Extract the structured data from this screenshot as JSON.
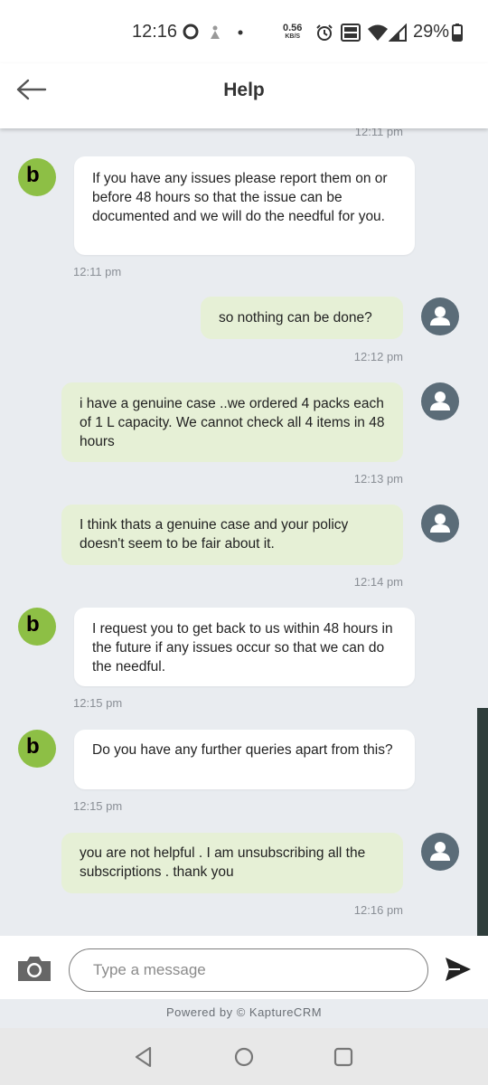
{
  "status_bar": {
    "time": "12:16",
    "net_speed": "0.56",
    "net_unit": "KB/S",
    "battery": "29%",
    "icons": [
      "circle-icon",
      "user-icon",
      "dot-icon",
      "alarm-icon",
      "vowifi-icon",
      "wifi-icon",
      "signal-icon",
      "battery-icon"
    ]
  },
  "header": {
    "title": "Help",
    "back_icon": "back-arrow-icon"
  },
  "messages": [
    {
      "sender": "agent",
      "text": "If you have any issues please report them on or before 48 hours so that the issue can be documented and we will do the needful for you.",
      "time": "12:11 pm"
    },
    {
      "sender": "user",
      "text": "so nothing can be done?",
      "time": "12:12 pm"
    },
    {
      "sender": "user",
      "text": "i have a genuine case ..we ordered 4 packs each of 1 L capacity. We cannot check all 4 items in 48 hours",
      "time": "12:13 pm"
    },
    {
      "sender": "user",
      "text": "I think thats a genuine case and your policy doesn't seem to be fair about it.",
      "time": "12:14 pm"
    },
    {
      "sender": "agent",
      "text": "I request you to get back to us within 48 hours in the future if any issues occur so that we can do the needful.",
      "time": "12:15 pm"
    },
    {
      "sender": "agent",
      "text": "Do you have any further queries apart from this?",
      "time": "12:15 pm"
    },
    {
      "sender": "user",
      "text": "you are not helpful . I am unsubscribing all the subscriptions . thank you",
      "time": "12:16 pm"
    }
  ],
  "top_partial_time": "12:11 pm",
  "bot_avatar_letters": {
    "first": "b",
    "second": "b"
  },
  "composer": {
    "placeholder": "Type a message",
    "value": "",
    "camera_icon": "camera-icon",
    "send_icon": "send-icon"
  },
  "powered_by": "Powered by © KaptureCRM",
  "nav": {
    "back": "nav-back-icon",
    "home": "nav-home-icon",
    "recents": "nav-recents-icon"
  },
  "colors": {
    "agent_bubble": "#ffffff",
    "user_bubble": "#e6f0d6",
    "chat_background": "#e9ecf0",
    "bot_avatar": "#8dbf45",
    "user_avatar": "#5b6c78",
    "brand_red": "#e43631"
  }
}
